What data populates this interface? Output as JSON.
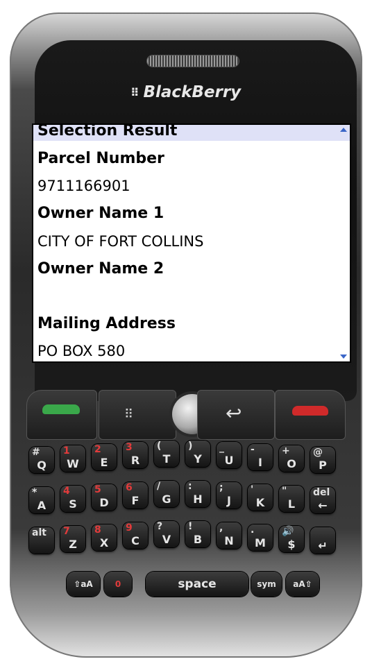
{
  "device": {
    "brand": "BlackBerry",
    "brand_logo": "⠿"
  },
  "screen": {
    "selection_result": "Selection Result",
    "fields": [
      {
        "label": "Parcel Number",
        "value": "9711166901"
      },
      {
        "label": "Owner Name 1",
        "value": "CITY OF FORT COLLINS"
      },
      {
        "label": "Owner Name 2",
        "value": ""
      },
      {
        "label": "Mailing Address",
        "value": "PO BOX 580"
      }
    ]
  },
  "nav": {
    "call_icon": "green-handset-icon",
    "menu_icon": "blackberry-menu-icon",
    "trackball_icon": "trackball-icon",
    "back_icon": "back-arrow-icon",
    "end_icon": "red-handset-icon",
    "back_glyph": "↩"
  },
  "keyboard": {
    "rows": [
      [
        {
          "main": "Q",
          "alt": "#",
          "alt_color": "white"
        },
        {
          "main": "W",
          "alt": "1",
          "alt_color": "red"
        },
        {
          "main": "E",
          "alt": "2",
          "alt_color": "red"
        },
        {
          "main": "R",
          "alt": "3",
          "alt_color": "red"
        },
        {
          "main": "T",
          "alt": "(",
          "alt_color": "white"
        },
        {
          "main": "Y",
          "alt": ")",
          "alt_color": "white"
        },
        {
          "main": "U",
          "alt": "_",
          "alt_color": "white"
        },
        {
          "main": "I",
          "alt": "-",
          "alt_color": "white"
        },
        {
          "main": "O",
          "alt": "+",
          "alt_color": "white"
        },
        {
          "main": "P",
          "alt": "@",
          "alt_color": "white"
        }
      ],
      [
        {
          "main": "A",
          "alt": "*",
          "alt_color": "white"
        },
        {
          "main": "S",
          "alt": "4",
          "alt_color": "red"
        },
        {
          "main": "D",
          "alt": "5",
          "alt_color": "red"
        },
        {
          "main": "F",
          "alt": "6",
          "alt_color": "red"
        },
        {
          "main": "G",
          "alt": "/",
          "alt_color": "white"
        },
        {
          "main": "H",
          "alt": ":",
          "alt_color": "white"
        },
        {
          "main": "J",
          "alt": ";",
          "alt_color": "white"
        },
        {
          "main": "K",
          "alt": "'",
          "alt_color": "white"
        },
        {
          "main": "L",
          "alt": "\"",
          "alt_color": "white"
        },
        {
          "main": "←",
          "alt": "del",
          "alt_color": "white"
        }
      ],
      [
        {
          "main": "",
          "alt": "alt",
          "alt_color": "white"
        },
        {
          "main": "Z",
          "alt": "7",
          "alt_color": "red"
        },
        {
          "main": "X",
          "alt": "8",
          "alt_color": "red"
        },
        {
          "main": "C",
          "alt": "9",
          "alt_color": "red"
        },
        {
          "main": "V",
          "alt": "?",
          "alt_color": "white"
        },
        {
          "main": "B",
          "alt": "!",
          "alt_color": "white"
        },
        {
          "main": "N",
          "alt": ",",
          "alt_color": "white"
        },
        {
          "main": "M",
          "alt": ".",
          "alt_color": "white"
        },
        {
          "main": "$",
          "alt": "🔊",
          "alt_color": "red"
        },
        {
          "main": "↵",
          "alt": "",
          "alt_color": "white"
        }
      ]
    ],
    "bottom": {
      "left_shift": "⇧aA",
      "zero": "0",
      "space": "space",
      "sym": "sym",
      "right_shift": "aA⇧"
    }
  }
}
